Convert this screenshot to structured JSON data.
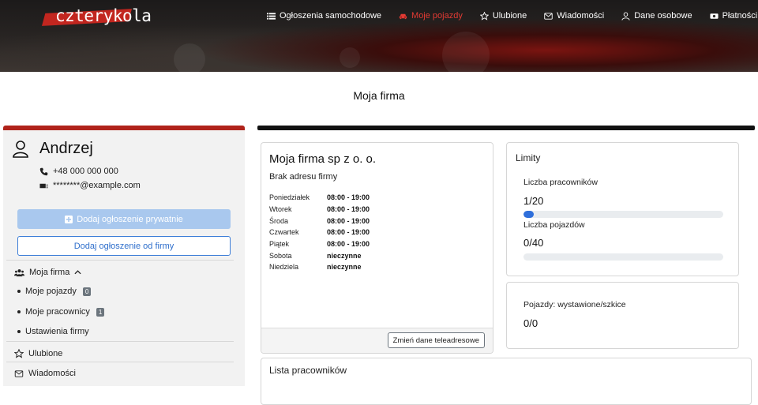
{
  "header": {
    "logo": "czterykola",
    "nav": [
      {
        "label": "Ogłoszenia samochodowe",
        "icon": "list-icon",
        "active": false
      },
      {
        "label": "Moje pojazdy",
        "icon": "car-icon",
        "active": true
      },
      {
        "label": "Ulubione",
        "icon": "star-icon",
        "active": false
      },
      {
        "label": "Wiadomości",
        "icon": "envelope-icon",
        "active": false
      },
      {
        "label": "Dane osobowe",
        "icon": "user-icon",
        "active": false
      },
      {
        "label": "Płatności",
        "icon": "money-icon",
        "active": false
      }
    ]
  },
  "page": {
    "title": "Moja firma"
  },
  "sidebar": {
    "user_name": "Andrzej",
    "phone": "+48 000 000 000",
    "email": "********@example.com",
    "btn_private": "Dodaj ogłoszenie prywatnie",
    "btn_company": "Dodaj ogłoszenie od firmy",
    "company_menu": "Moja firma",
    "sub_items": [
      {
        "label": "Moje pojazdy",
        "badge": "0"
      },
      {
        "label": "Moje pracownicy",
        "badge": "1"
      },
      {
        "label": "Ustawienia firmy",
        "badge": null
      }
    ],
    "favorites": "Ulubione",
    "messages": "Wiadomości"
  },
  "company": {
    "name": "Moja firma sp z o. o.",
    "address": "Brak adresu firmy",
    "hours": [
      {
        "day": "Poniedziałek",
        "time": "08:00 - 19:00"
      },
      {
        "day": "Wtorek",
        "time": "08:00 - 19:00"
      },
      {
        "day": "Środa",
        "time": "08:00 - 19:00"
      },
      {
        "day": "Czwartek",
        "time": "08:00 - 19:00"
      },
      {
        "day": "Piątek",
        "time": "08:00 - 19:00"
      },
      {
        "day": "Sobota",
        "time": "nieczynne"
      },
      {
        "day": "Niedziela",
        "time": "nieczynne"
      }
    ],
    "change_button": "Zmień dane teleadresowe"
  },
  "limits": {
    "title": "Limity",
    "employees_label": "Liczba pracowników",
    "employees_value": "1/20",
    "employees_fraction": 0.05,
    "vehicles_label": "Liczba pojazdów",
    "vehicles_value": "0/40",
    "vehicles_fraction": 0
  },
  "stats": {
    "label": "Pojazdy: wystawione/szkice",
    "value": "0/0"
  },
  "employees_list": {
    "title": "Lista pracowników"
  },
  "colors": {
    "accent_red": "#b0231b",
    "active_nav": "#e23a33",
    "primary_blue": "#2f6fdb"
  }
}
